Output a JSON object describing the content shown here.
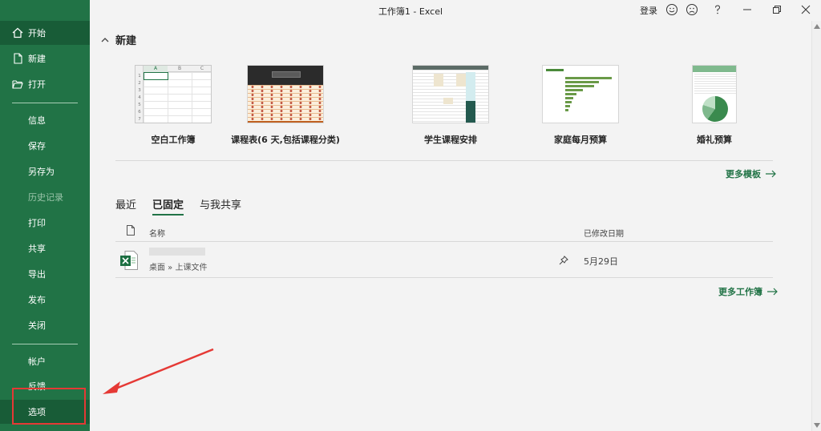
{
  "window": {
    "title": "工作簿1  -  Excel",
    "signin": "登录"
  },
  "sidebar": {
    "items": [
      {
        "label": "开始",
        "icon": "home-icon"
      },
      {
        "label": "新建",
        "icon": "new-file-icon"
      },
      {
        "label": "打开",
        "icon": "open-folder-icon"
      },
      {
        "label": "信息"
      },
      {
        "label": "保存"
      },
      {
        "label": "另存为"
      },
      {
        "label": "历史记录"
      },
      {
        "label": "打印"
      },
      {
        "label": "共享"
      },
      {
        "label": "导出"
      },
      {
        "label": "发布"
      },
      {
        "label": "关闭"
      },
      {
        "label": "帐户"
      },
      {
        "label": "反馈"
      },
      {
        "label": "选项"
      }
    ]
  },
  "new_section": {
    "heading": "新建",
    "templates": [
      {
        "label": "空白工作簿"
      },
      {
        "label": "课程表(6 天,包括课程分类)"
      },
      {
        "label": "学生课程安排"
      },
      {
        "label": "家庭每月预算"
      },
      {
        "label": "婚礼预算"
      }
    ],
    "blank_cols": [
      "A",
      "B",
      "C"
    ],
    "blank_rows": [
      "1",
      "2",
      "3",
      "4",
      "5",
      "6",
      "7"
    ],
    "more_templates": "更多模板"
  },
  "recent": {
    "tabs": [
      "最近",
      "已固定",
      "与我共享"
    ],
    "active_tab": "已固定",
    "col_name": "名称",
    "col_modified": "已修改日期",
    "files": [
      {
        "path": "桌面 » 上课文件",
        "modified": "5月29日"
      }
    ],
    "more_workbooks": "更多工作簿"
  },
  "colors": {
    "brand": "#217346",
    "brand_dark": "#185c37",
    "annotation": "#e53935"
  }
}
